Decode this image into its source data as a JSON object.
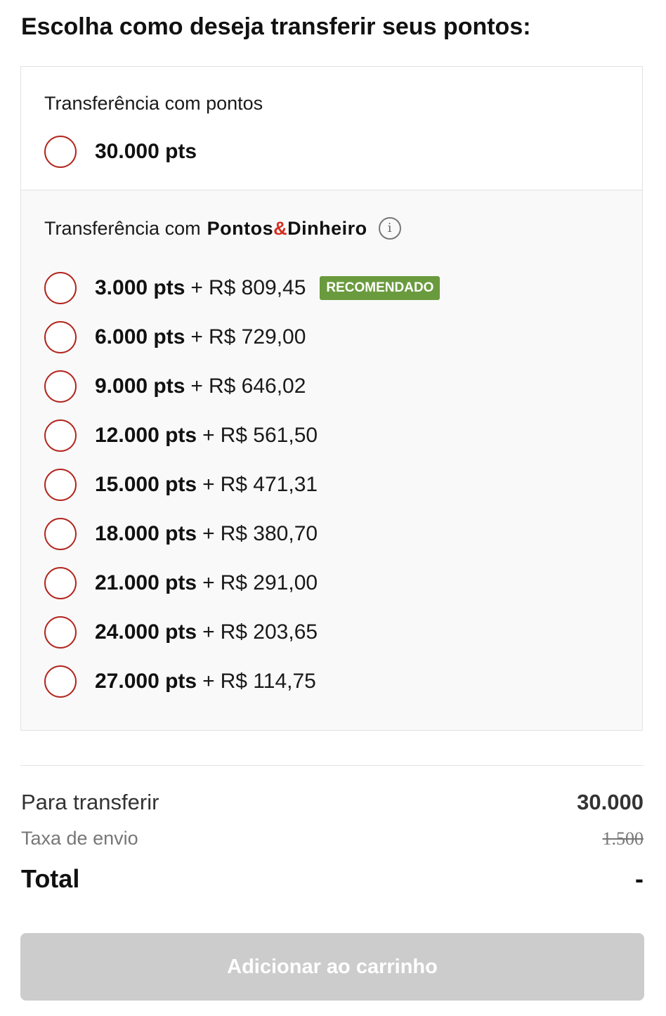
{
  "page": {
    "title": "Escolha como deseja transferir seus pontos:"
  },
  "points_section": {
    "heading": "Transferência com pontos",
    "option": {
      "points": "30.000 pts"
    }
  },
  "mixed_section": {
    "heading_prefix": "Transferência com",
    "brand_part1": "Pontos",
    "brand_amp": "&",
    "brand_part2": "Dinheiro",
    "separator": "+",
    "options": [
      {
        "points": "3.000 pts",
        "money": "R$ 809,45",
        "badge": "RECOMENDADO"
      },
      {
        "points": "6.000 pts",
        "money": "R$ 729,00"
      },
      {
        "points": "9.000 pts",
        "money": "R$ 646,02"
      },
      {
        "points": "12.000 pts",
        "money": "R$ 561,50"
      },
      {
        "points": "15.000 pts",
        "money": "R$ 471,31"
      },
      {
        "points": "18.000 pts",
        "money": "R$ 380,70"
      },
      {
        "points": "21.000 pts",
        "money": "R$ 291,00"
      },
      {
        "points": "24.000 pts",
        "money": "R$ 203,65"
      },
      {
        "points": "27.000 pts",
        "money": "R$ 114,75"
      }
    ]
  },
  "summary": {
    "transfer_label": "Para transferir",
    "transfer_value": "30.000",
    "fee_label": "Taxa de envio",
    "fee_value": "1.500",
    "total_label": "Total",
    "total_value": "-"
  },
  "cta": {
    "label": "Adicionar ao carrinho"
  },
  "icons": {
    "info": "info-icon",
    "radio": "radio-unchecked-icon"
  },
  "colors": {
    "radio_border": "#b3261e",
    "brand_amp": "#d42e1f",
    "badge_bg": "#6a9a3e",
    "button_disabled_bg": "#cccccc"
  }
}
